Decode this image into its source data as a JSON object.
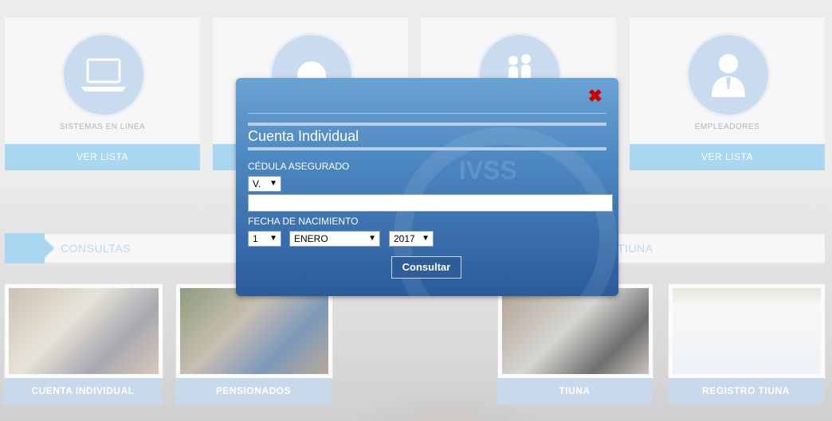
{
  "cards": [
    {
      "label": "SISTEMAS EN LINEA",
      "button": "VER LISTA",
      "icon": "laptop-icon"
    },
    {
      "label": "",
      "button": "",
      "icon": "face-icon"
    },
    {
      "label": "",
      "button": "",
      "icon": "elderly-couple-icon"
    },
    {
      "label": "EMPLEADORES",
      "button": "VER LISTA",
      "icon": "employer-icon"
    }
  ],
  "sections": {
    "consultas": "CONSULTAS",
    "tiuna": "TIUNA"
  },
  "thumbnails": [
    {
      "label": "CUENTA INDIVIDUAL"
    },
    {
      "label": "PENSIONADOS"
    },
    {
      "label": "TIUNA"
    },
    {
      "label": "REGISTRO TIUNA"
    }
  ],
  "modal": {
    "title": "Cuenta Individual",
    "watermark": "IVSS",
    "cedula_label": "CÉDULA ASEGURADO",
    "nationality": "V.",
    "cedula_value": "",
    "fecha_label": "FECHA DE NACIMIENTO",
    "day": "1",
    "month": "ENERO",
    "year": "2017",
    "submit": "Consultar"
  },
  "colors": {
    "accent_light": "#a9d6f0",
    "modal_blue": "#4b86c0",
    "close_red": "#d10000"
  }
}
